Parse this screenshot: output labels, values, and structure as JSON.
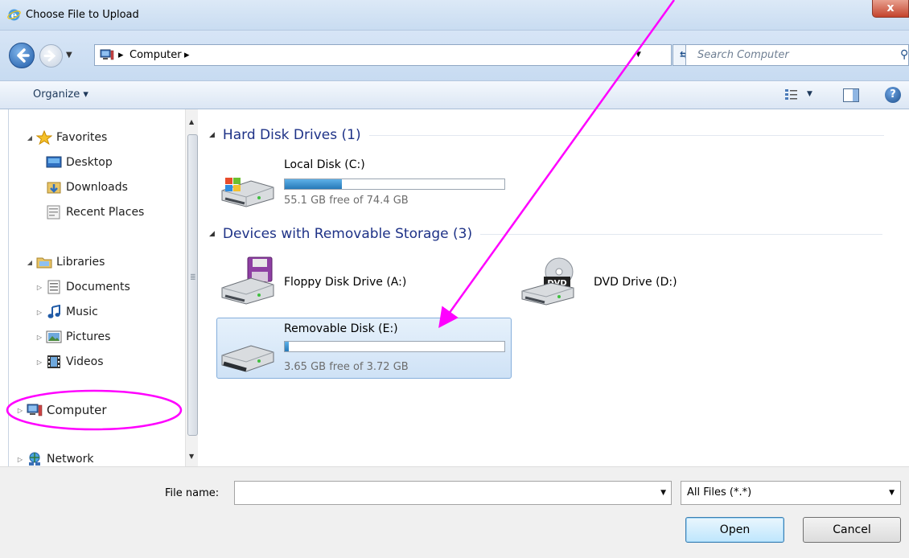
{
  "window": {
    "title": "Choose File to Upload",
    "close_label": "x"
  },
  "address": {
    "crumbs": [
      "Computer"
    ],
    "search_placeholder": "Search Computer"
  },
  "toolbar": {
    "organize_label": "Organize ▾"
  },
  "sidebar": {
    "items": [
      {
        "label": "Favorites",
        "icon": "star-icon",
        "expanded": true
      },
      {
        "label": "Desktop",
        "icon": "desktop-icon"
      },
      {
        "label": "Downloads",
        "icon": "downloads-folder-icon"
      },
      {
        "label": "Recent Places",
        "icon": "recent-places-icon"
      },
      {
        "label": "Libraries",
        "icon": "libraries-folder-icon",
        "expanded": true
      },
      {
        "label": "Documents",
        "icon": "documents-icon"
      },
      {
        "label": "Music",
        "icon": "music-icon"
      },
      {
        "label": "Pictures",
        "icon": "pictures-icon"
      },
      {
        "label": "Videos",
        "icon": "videos-icon"
      },
      {
        "label": "Computer",
        "icon": "computer-icon",
        "highlighted": true
      },
      {
        "label": "Network",
        "icon": "network-icon"
      }
    ]
  },
  "groups": {
    "hard_disk": "Hard Disk Drives (1)",
    "removable": "Devices with Removable Storage (3)"
  },
  "drives": [
    {
      "name": "Local Disk (C:)",
      "free_text": "55.1 GB free of 74.4 GB",
      "used_fraction": 0.26,
      "icon": "windows-hard-drive-icon"
    },
    {
      "name": "Floppy Disk Drive (A:)",
      "icon": "floppy-drive-icon"
    },
    {
      "name": "DVD Drive (D:)",
      "icon": "dvd-drive-icon",
      "badge": "DVD"
    },
    {
      "name": "Removable Disk (E:)",
      "free_text": "3.65 GB free of 3.72 GB",
      "used_fraction": 0.02,
      "icon": "removable-disk-icon",
      "selected": true
    }
  ],
  "footer": {
    "file_name_label": "File name:",
    "file_name_value": "",
    "filter_value": "All Files (*.*)",
    "open_label": "Open",
    "cancel_label": "Cancel"
  },
  "colors": {
    "accent": "#1e3287",
    "annotation": "#ff00ff",
    "selection": "#cfe2f6"
  }
}
